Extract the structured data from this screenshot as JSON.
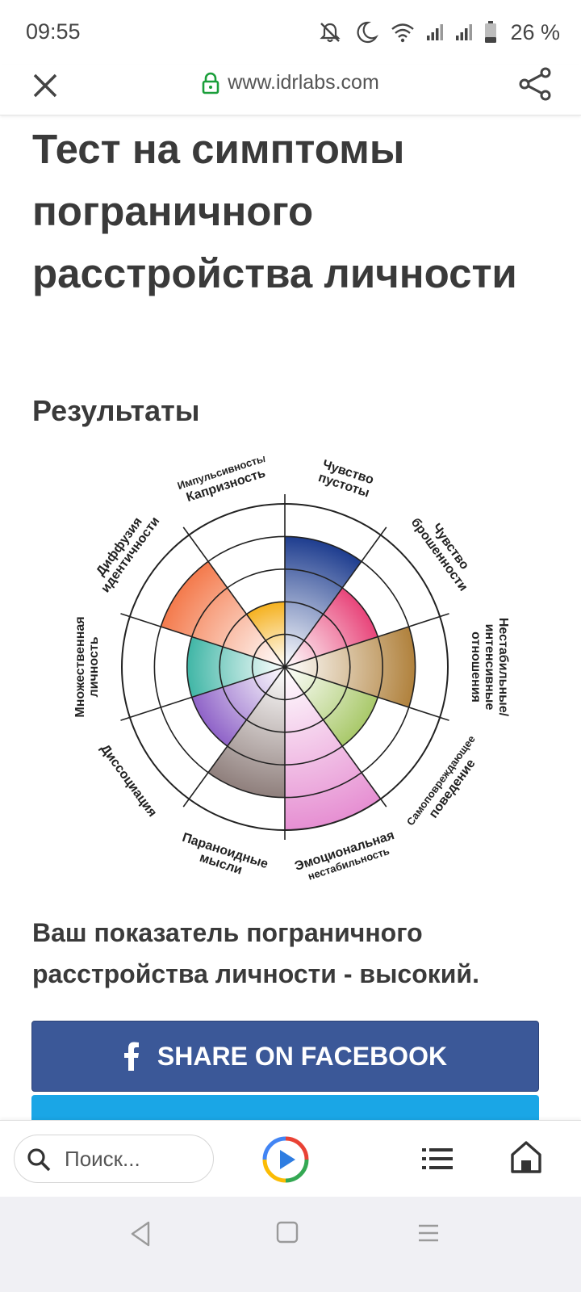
{
  "status_bar": {
    "time": "09:55",
    "battery": "26 %",
    "icons": [
      "mute-icon",
      "moon-icon",
      "wifi-icon",
      "signal-icon",
      "signal-icon",
      "battery-icon"
    ]
  },
  "browser": {
    "url": "www.idrlabs.com",
    "icons": [
      "close-icon",
      "lock-icon",
      "share-icon"
    ]
  },
  "page": {
    "title": "Тест на симптомы пограничного расстройства личности",
    "results_heading": "Результаты",
    "result_text": "Ваш показатель пограничного расстройства личности - высокий.",
    "facebook_button": "SHARE ON FACEBOOK"
  },
  "chart_data": {
    "type": "polar-area",
    "title": "",
    "categories": [
      {
        "name": "Чувство пустоты",
        "label": [
          "Чувство",
          "пустоты"
        ],
        "value": 4,
        "color": "#1e3d8f"
      },
      {
        "name": "Чувство брошенности",
        "label": [
          "Чувство",
          "брошенности"
        ],
        "value": 3,
        "color": "#e8457a"
      },
      {
        "name": "Нестабильные/интенсивные отношения",
        "label": [
          "Нестабильные/",
          "интенсивные",
          "отношения"
        ],
        "value": 4,
        "color": "#b0813c"
      },
      {
        "name": "Самоповреждающее поведение",
        "label": [
          "Самоповреждающее",
          "поведение"
        ],
        "value": 3,
        "color": "#a9c96a"
      },
      {
        "name": "Эмоциональная нестабильность",
        "label": [
          "Эмоциональная",
          "нестабильность"
        ],
        "value": 5,
        "color": "#e68fd2"
      },
      {
        "name": "Параноидные мысли",
        "label": [
          "Параноидные",
          "мысли"
        ],
        "value": 4,
        "color": "#8f7f7c"
      },
      {
        "name": "Диссоциация",
        "label": [
          "Диссоциация"
        ],
        "value": 3,
        "color": "#8f63c8"
      },
      {
        "name": "Множественная личность",
        "label": [
          "Множественная",
          "личность"
        ],
        "value": 3,
        "color": "#40b6a6"
      },
      {
        "name": "Диффузия идентичности",
        "label": [
          "Диффузия",
          "идентичности"
        ],
        "value": 4,
        "color": "#f47a4c"
      },
      {
        "name": "Импульсивность/Капризность",
        "label": [
          "Импульсивность/",
          "Капризность"
        ],
        "value": 2,
        "color": "#f5b11f"
      }
    ],
    "scale_max": 5,
    "rings": 5,
    "legend": "none",
    "grid": true
  },
  "bottom_bar": {
    "search_placeholder": "Поиск...",
    "icons": [
      "search-icon",
      "play-logo-icon",
      "list-icon",
      "home-icon"
    ]
  },
  "nav_bar": {
    "icons": [
      "back-icon",
      "recent-apps-icon",
      "menu-icon"
    ]
  }
}
